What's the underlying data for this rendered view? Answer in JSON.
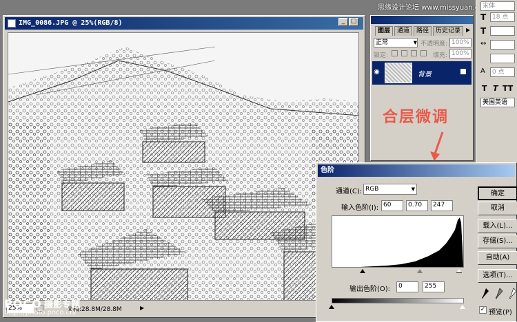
{
  "watermark_top": "思缘设计论坛  www.missyuan.com",
  "document": {
    "title": "IMG_0086.JPG @ 25%(RGB/8)",
    "zoom": "25%",
    "doc_info": "文档:28.8M/28.8M"
  },
  "layers_panel": {
    "tabs": [
      "图层",
      "通道",
      "路径",
      "历史记录"
    ],
    "blend_mode": "正常",
    "opacity_label": "不透明度:",
    "opacity_value": "100%",
    "lock_label": "锁定:",
    "fill_label": "填充:",
    "fill_value": "100%",
    "layer_name": "背景"
  },
  "char_panel": {
    "font_label": "宋体",
    "size_value": "18 点",
    "leading_value": "0 点",
    "style_labels": [
      "T",
      "T",
      "TT"
    ],
    "language": "美国英语"
  },
  "annotation": "合层微调",
  "levels": {
    "title": "色阶",
    "channel_label": "通道(C):",
    "channel_value": "RGB",
    "input_label": "输入色阶(I):",
    "input_black": "60",
    "input_gamma": "0.70",
    "input_white": "247",
    "output_label": "输出色阶(O):",
    "output_black": "0",
    "output_white": "255",
    "buttons": {
      "ok": "确定",
      "cancel": "取消",
      "load": "载入(L)...",
      "save": "存储(S)...",
      "auto": "自动(A)",
      "options": "选项(T)..."
    },
    "preview_label": "预览(P)",
    "preview_checked": true
  },
  "footer": {
    "brand": "POCO",
    "brand_sub": "摄影专题",
    "url": "http://photo.poco.cn/"
  },
  "colors": {
    "titlebar": "#0a246a",
    "annotation": "#ea5a4a",
    "dialog_bg": "#d4d0c8"
  }
}
